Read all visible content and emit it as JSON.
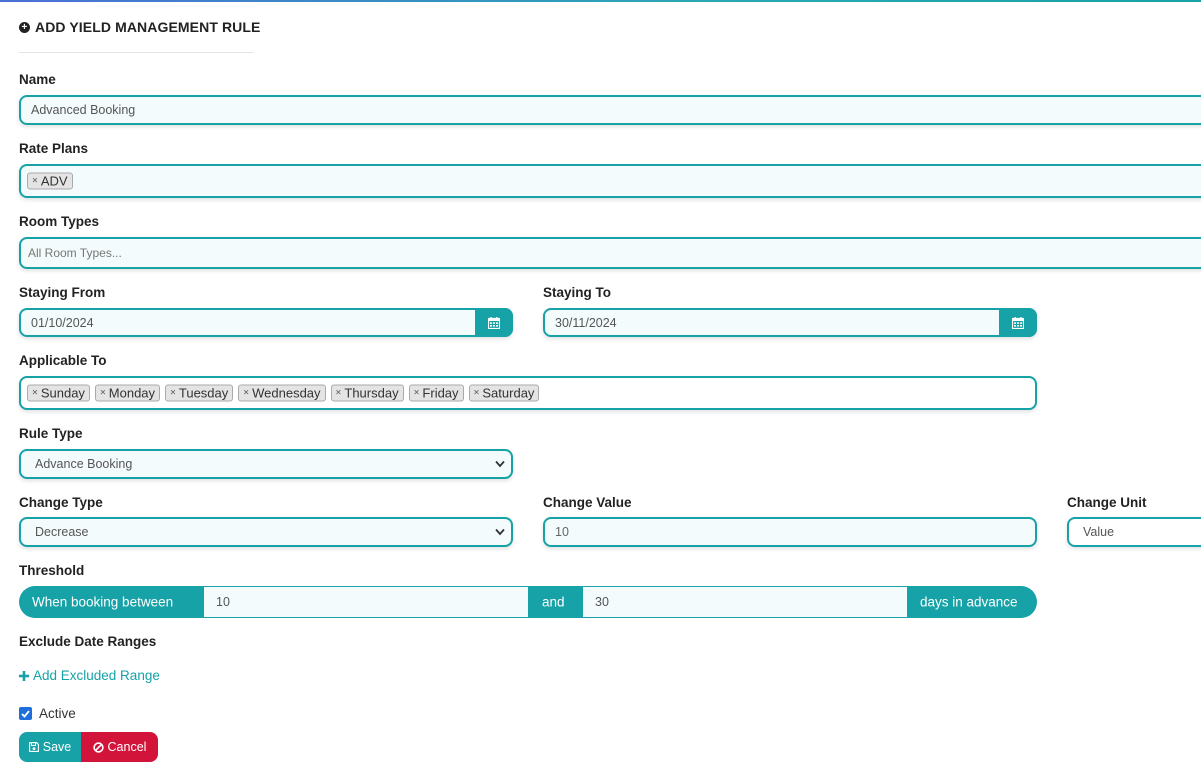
{
  "header": {
    "title": "ADD YIELD MANAGEMENT RULE",
    "icon": "plus-circle-icon"
  },
  "fields": {
    "name": {
      "label": "Name",
      "value": "Advanced Booking"
    },
    "rate_plans": {
      "label": "Rate Plans",
      "tags": [
        "ADV"
      ]
    },
    "room_types": {
      "label": "Room Types",
      "placeholder": "All Room Types..."
    },
    "staying_from": {
      "label": "Staying From",
      "value": "01/10/2024"
    },
    "staying_to": {
      "label": "Staying To",
      "value": "30/11/2024"
    },
    "applicable_to": {
      "label": "Applicable To",
      "tags": [
        "Sunday",
        "Monday",
        "Tuesday",
        "Wednesday",
        "Thursday",
        "Friday",
        "Saturday"
      ]
    },
    "rule_type": {
      "label": "Rule Type",
      "value": "Advance Booking"
    },
    "change_type": {
      "label": "Change Type",
      "value": "Decrease"
    },
    "change_value": {
      "label": "Change Value",
      "value": "10"
    },
    "change_unit": {
      "label": "Change Unit",
      "value": "Value"
    }
  },
  "threshold": {
    "label": "Threshold",
    "prefix": "When booking between",
    "from": "10",
    "conjunction": "and",
    "to": "30",
    "suffix": "days in advance"
  },
  "exclude": {
    "label": "Exclude Date Ranges",
    "add_link": "Add Excluded Range"
  },
  "active": {
    "label": "Active",
    "checked": true
  },
  "buttons": {
    "save": "Save",
    "cancel": "Cancel"
  },
  "tag_remove_glyph": "×",
  "colors": {
    "accent": "#17a2a7",
    "danger": "#d2143a",
    "checkbox": "#1e6fdc"
  }
}
